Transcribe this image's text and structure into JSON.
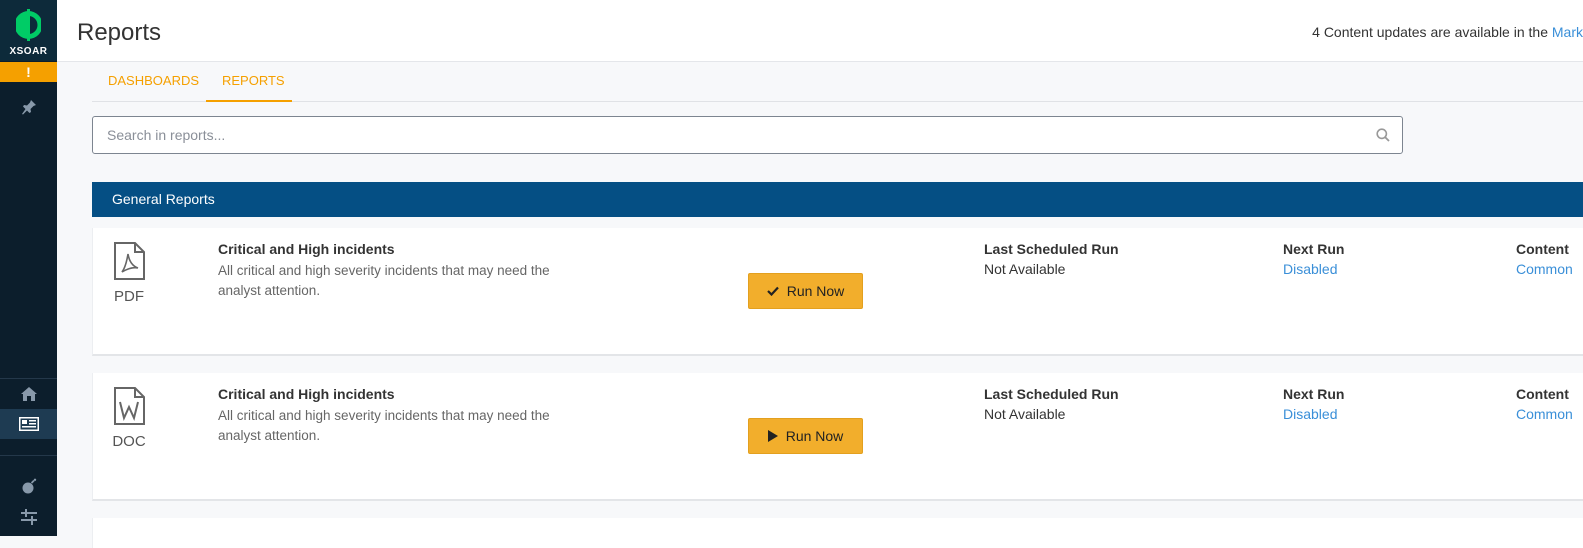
{
  "app": {
    "logo_text": "XSOAR",
    "alert_mark": "!"
  },
  "header": {
    "title": "Reports",
    "updates_text": "4 Content updates are available in the ",
    "updates_link": "Mark"
  },
  "tabs": [
    {
      "label": "DASHBOARDS"
    },
    {
      "label": "REPORTS"
    }
  ],
  "search": {
    "placeholder": "Search in reports..."
  },
  "section": {
    "title": "General Reports"
  },
  "reports": [
    {
      "file_type": "PDF",
      "title": "Critical and High incidents",
      "description": "All critical and high severity incidents that may need the analyst attention.",
      "run_label": "Run Now",
      "run_icon": "check-icon",
      "last_run_label": "Last Scheduled Run",
      "last_run_value": "Not Available",
      "next_run_label": "Next Run",
      "next_run_value": "Disabled",
      "content_label": "Content",
      "content_value": "Common"
    },
    {
      "file_type": "DOC",
      "title": "Critical and High incidents",
      "description": "All critical and high severity incidents that may need the analyst attention.",
      "run_label": "Run Now",
      "run_icon": "play-icon",
      "last_run_label": "Last Scheduled Run",
      "last_run_value": "Not Available",
      "next_run_label": "Next Run",
      "next_run_value": "Disabled",
      "content_label": "Content",
      "content_value": "Common"
    }
  ],
  "colors": {
    "accent": "#f5a000",
    "section_bg": "#054f84",
    "link": "#3a8fd8",
    "sidebar_bg": "#0c1e2c"
  }
}
